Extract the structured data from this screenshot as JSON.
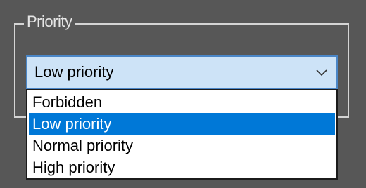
{
  "priority_group": {
    "title": "Priority",
    "combo": {
      "selected_value": "Low priority",
      "arrow_icon": "chevron-down-icon"
    },
    "options": [
      {
        "label": "Forbidden",
        "selected": false
      },
      {
        "label": "Low priority",
        "selected": true
      },
      {
        "label": "Normal priority",
        "selected": false
      },
      {
        "label": "High priority",
        "selected": false
      }
    ]
  },
  "colors": {
    "background": "#575757",
    "combo_background": "#cde3f7",
    "combo_border": "#4a86c7",
    "highlight": "#0078d7",
    "group_border": "#d4d4d4"
  }
}
